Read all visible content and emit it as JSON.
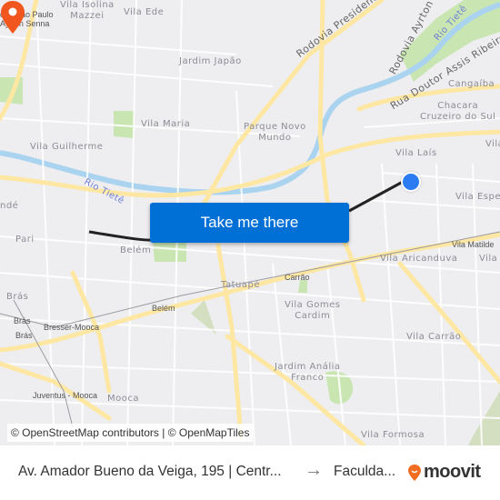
{
  "map": {
    "neighborhoods": [
      {
        "name": "Vila Isolina\nMazzei"
      },
      {
        "name": "Vila Ede"
      },
      {
        "name": "Jardim Japão"
      },
      {
        "name": "Vila Maria"
      },
      {
        "name": "Vila Guilherme"
      },
      {
        "name": "Parque Novo\nMundo"
      },
      {
        "name": "Cangaíba"
      },
      {
        "name": "Chacara\nCruzeiro do Sul"
      },
      {
        "name": "Vila Laís"
      },
      {
        "name": "Vila Espe"
      },
      {
        "name": "Vila Aricanduva"
      },
      {
        "name": "Pari"
      },
      {
        "name": "Belém"
      },
      {
        "name": "Brás"
      },
      {
        "name": "Tatuapé"
      },
      {
        "name": "Vila Gomes\nCardim"
      },
      {
        "name": "Vila Carrão"
      },
      {
        "name": "Jardim Anália\nFranco"
      },
      {
        "name": "Vila Formosa"
      },
      {
        "name": "Mooca"
      },
      {
        "name": "Vila"
      },
      {
        "name": "ndé"
      },
      {
        "name": "Vila"
      }
    ],
    "stations": [
      {
        "name": "Carrão"
      },
      {
        "name": "Belém"
      },
      {
        "name": "Bresser-Mooca"
      },
      {
        "name": "Brás"
      },
      {
        "name": "Brás"
      },
      {
        "name": "Juventus - Mooca"
      },
      {
        "name": "Vila Matilde"
      },
      {
        "name": "dim São Paulo\nAyrton Senna"
      }
    ],
    "roads": [
      {
        "name": "Rodovia Presidente"
      },
      {
        "name": "Rodovia Ayrton Senna"
      },
      {
        "name": "Rua Doutor Assis Ribeiro"
      }
    ],
    "rivers": [
      {
        "name": "Rio Tietê"
      },
      {
        "name": "Rio Tietê"
      }
    ],
    "attribution": "© OpenStreetMap contributors | © OpenMapTiles",
    "origin_marker": "origin-dot",
    "destination_marker": "destination-pin",
    "route_color": "#222222",
    "pin_color": "#f0561d",
    "origin_color": "#2b7bf2"
  },
  "cta": {
    "label": "Take me there",
    "color": "#0070d6"
  },
  "footer": {
    "from": "Av. Amador Bueno da Veiga, 195 | Centr...",
    "arrow": "→",
    "to": "Faculda...",
    "brand": "moovit",
    "brand_color": "#f26c21"
  }
}
